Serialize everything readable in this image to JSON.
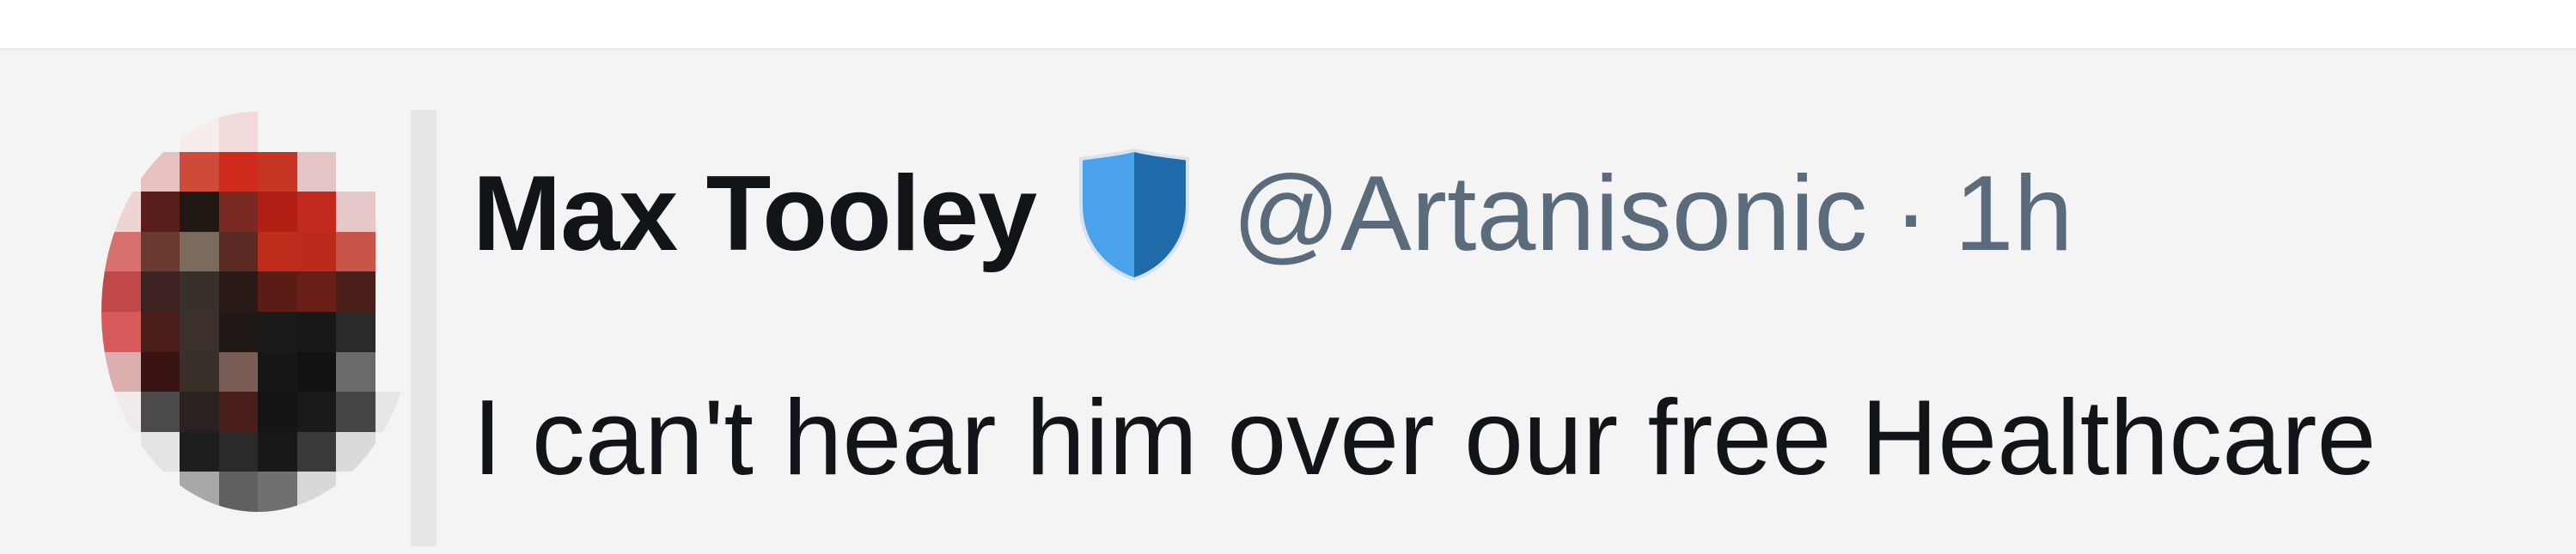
{
  "post": {
    "author": {
      "display_name": "Max Tooley",
      "handle": "@Artanisonic",
      "badge_icon": "shield-icon",
      "badge_colors": [
        "#4aa3ea",
        "#1f6aa8"
      ]
    },
    "separator": "·",
    "timestamp": "1h",
    "text": "I can't hear him over our free Healthcare"
  },
  "avatar": {
    "icon": "pixelated-avatar",
    "pixels": [
      [
        "#f4f4f4",
        "#f4f4f4",
        "#f6ecec",
        "#f2dada",
        "#f4f4f4",
        "#f4f4f4",
        "#f4f4f4",
        "#f4f4f4"
      ],
      [
        "#f4f4f4",
        "#e8c0c0",
        "#d04a3a",
        "#cf2a1c",
        "#c83424",
        "#e4c4c4",
        "#f4f4f4",
        "#f4f4f4"
      ],
      [
        "#f0d4d4",
        "#5a1e1a",
        "#211814",
        "#7a2a22",
        "#b21e14",
        "#c12a1c",
        "#e6c8c8",
        "#f4f4f4"
      ],
      [
        "#d97070",
        "#6a3a30",
        "#7c6a5c",
        "#5a2a22",
        "#c02c1c",
        "#bc2a1c",
        "#c8544a",
        "#f4f4f4"
      ],
      [
        "#c04848",
        "#3c2220",
        "#3a302a",
        "#2a1a16",
        "#5c1c16",
        "#6a1e18",
        "#4c1e1a",
        "#f4f4f4"
      ],
      [
        "#d85a5a",
        "#4a1c1a",
        "#3c302c",
        "#201814",
        "#1a1a1a",
        "#181818",
        "#2a2a2a",
        "#f4f4f4"
      ],
      [
        "#dcaeae",
        "#3a1414",
        "#3a302a",
        "#7a5c56",
        "#161616",
        "#121212",
        "#6a6a6a",
        "#f4f4f4"
      ],
      [
        "#f0eaea",
        "#4a4a4a",
        "#2a2220",
        "#4a1e1a",
        "#141414",
        "#1a1a1a",
        "#444444",
        "#e6e6e6"
      ],
      [
        "#f4f4f4",
        "#e4e4e4",
        "#1e1e1e",
        "#2a2a2a",
        "#181818",
        "#3a3a3a",
        "#dadada",
        "#f4f4f4"
      ],
      [
        "#f4f4f4",
        "#f4f4f4",
        "#a8a8a8",
        "#606060",
        "#707070",
        "#d8d8d8",
        "#f4f4f4",
        "#f4f4f4"
      ]
    ]
  }
}
